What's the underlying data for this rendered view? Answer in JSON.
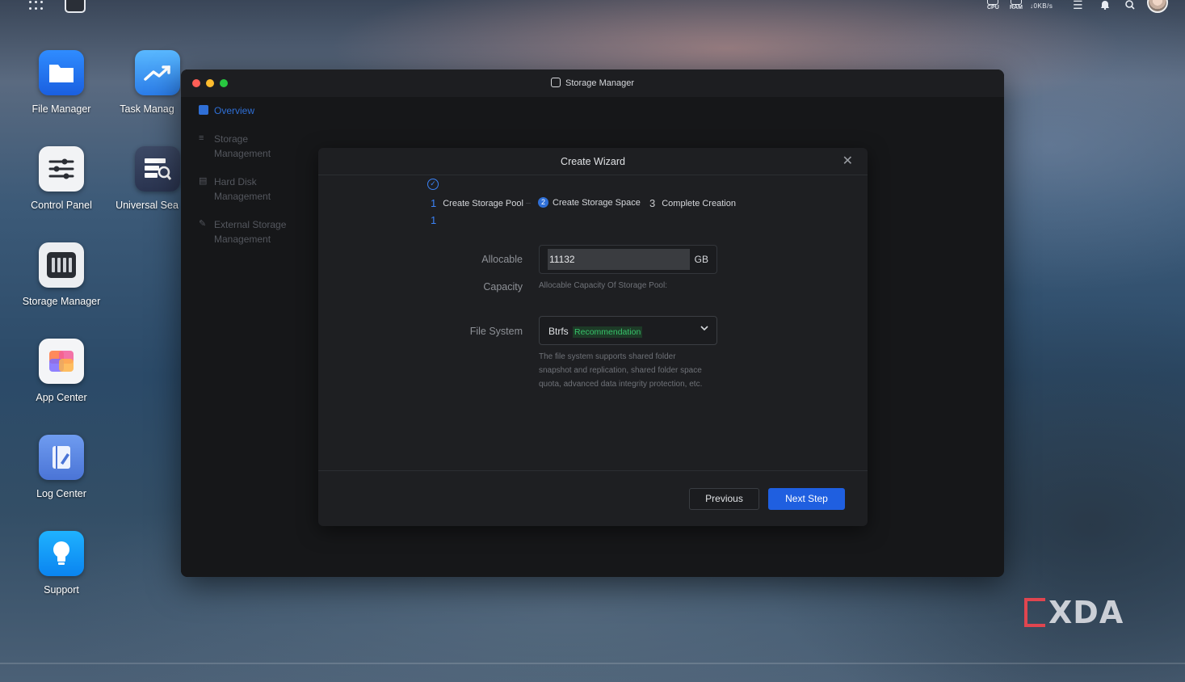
{
  "topbar": {
    "cpu_label": "CPU",
    "ram_label": "RAM",
    "net_speed": "↓0KB/s"
  },
  "desktop": {
    "icons": [
      {
        "label": "File Manager"
      },
      {
        "label": "Task Manag"
      },
      {
        "label": "Control Panel"
      },
      {
        "label": "Universal Sea"
      },
      {
        "label": "Storage Manager"
      },
      {
        "label": "App Center"
      },
      {
        "label": "Log Center"
      },
      {
        "label": "Support"
      }
    ]
  },
  "window": {
    "title": "Storage Manager",
    "sidebar": [
      {
        "label": "Overview",
        "active": true
      },
      {
        "label": "Storage Management"
      },
      {
        "label": "Hard Disk Management"
      },
      {
        "label": "External Storage Management"
      }
    ]
  },
  "wizard": {
    "title": "Create Wizard",
    "steps": [
      {
        "num": "1",
        "label": "Create Storage Pool"
      },
      {
        "num": "2",
        "label": "Create Storage Space"
      },
      {
        "num": "3",
        "label": "Complete Creation"
      }
    ],
    "step_one_extra": "1",
    "allocable_label": "Allocable",
    "capacity_label": "Capacity",
    "allocable_value": "11132",
    "allocable_unit": "GB",
    "allocable_hint": "Allocable Capacity Of Storage Pool:",
    "file_system_label": "File System",
    "file_system_value": "Btrfs",
    "file_system_badge": "Recommendation",
    "file_system_hint": [
      "The file system supports shared folder",
      "snapshot and replication, shared folder space",
      "quota, advanced data integrity protection, etc."
    ],
    "previous_label": "Previous",
    "next_label": "Next Step"
  },
  "watermark": "XDA",
  "colors": {
    "accent": "#1f5fe0",
    "recommend_green": "#37c26a"
  }
}
